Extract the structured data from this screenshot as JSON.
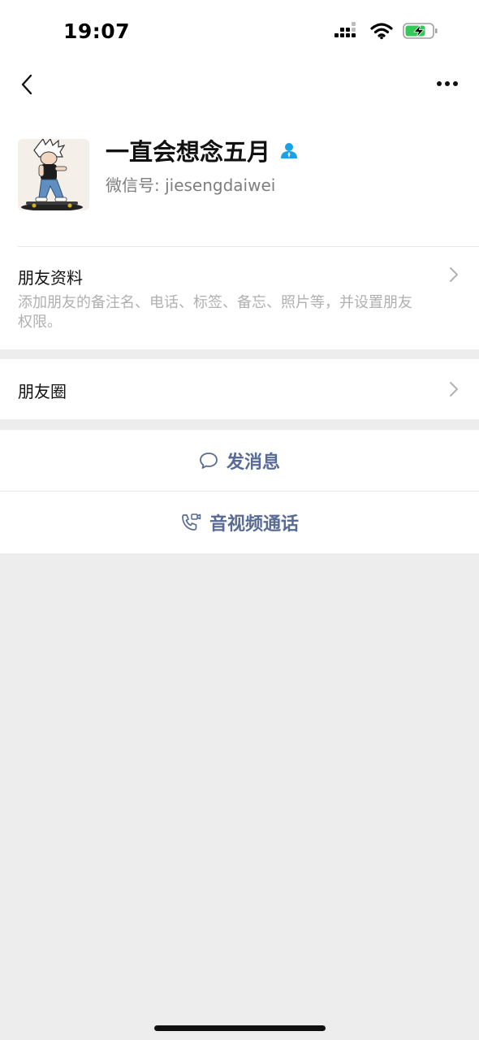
{
  "status_bar": {
    "time": "19:07",
    "signal_icon": "cellular-signal-icon",
    "wifi_icon": "wifi-icon",
    "battery_icon": "battery-charging-icon",
    "battery_color": "#34c759"
  },
  "nav": {
    "back_icon": "chevron-left-icon",
    "more_icon": "more-dots-icon"
  },
  "profile": {
    "nickname": "一直会想念五月",
    "badge_icon": "person-icon",
    "badge_color": "#1aa1e6",
    "wechat_id": "微信号: jiesengdaiwei",
    "avatar_icon": "cartoon-skateboarder-avatar"
  },
  "friend_info": {
    "title": "朋友资料",
    "description": "添加朋友的备注名、电话、标签、备忘、照片等，并设置朋友权限。"
  },
  "moments": {
    "title": "朋友圈"
  },
  "actions": {
    "message_label": "发消息",
    "message_icon": "chat-bubble-icon",
    "call_label": "音视频通话",
    "call_icon": "video-call-icon",
    "accent_color": "#576b95"
  }
}
